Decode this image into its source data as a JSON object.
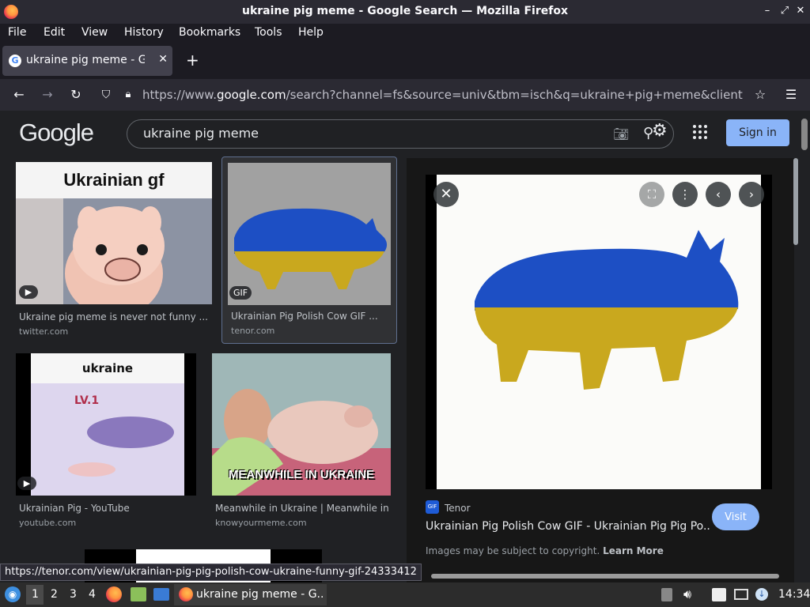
{
  "window": {
    "title": "ukraine pig meme - Google Search — Mozilla Firefox"
  },
  "menu": [
    "File",
    "Edit",
    "View",
    "History",
    "Bookmarks",
    "Tools",
    "Help"
  ],
  "tab": {
    "label": "ukraine pig meme - Google Search",
    "favicon": "G"
  },
  "url": {
    "prefix": "https://www.",
    "domain": "google.com",
    "path": "/search?channel=fs&source=univ&tbm=isch&q=ukraine+pig+meme&client=ubuntu"
  },
  "google": {
    "logo": "Google",
    "query": "ukraine pig meme",
    "signin": "Sign in"
  },
  "results": [
    {
      "title": "Ukraine pig meme is never not funny ...",
      "source": "twitter.com",
      "thumb_text": "Ukrainian gf",
      "badge": "▶"
    },
    {
      "title": "Ukrainian Pig Polish Cow GIF ...",
      "source": "tenor.com",
      "badge": "GIF"
    },
    {
      "title": "Ukrainian Pig - YouTube",
      "source": "youtube.com",
      "thumb_text": "ukraine",
      "thumb_text2": "LV.1",
      "badge": "▶"
    },
    {
      "title": "Meanwhile in Ukraine | Meanwhile in ...",
      "source": "knowyourmeme.com",
      "thumb_text": "MEANWHILE IN UKRAINE"
    }
  ],
  "panel": {
    "source": "Tenor",
    "title": "Ukrainian Pig Polish Cow GIF - Ukrainian Pig Pig Po...",
    "visit": "Visit",
    "copyright": "Images may be subject to copyright.",
    "learn_more": "Learn More",
    "source_icon": "GIF"
  },
  "status_url": "https://tenor.com/view/ukrainian-pig-pig-polish-cow-ukraine-funny-gif-24333412",
  "taskbar": {
    "workspaces": [
      "1",
      "2",
      "3",
      "4"
    ],
    "app_label": "ukraine pig meme - G...",
    "time": "14:34"
  },
  "colors": {
    "ukraine_blue": "#1d4fc4",
    "ukraine_yellow": "#c9a81e",
    "accent": "#8ab4f8"
  }
}
